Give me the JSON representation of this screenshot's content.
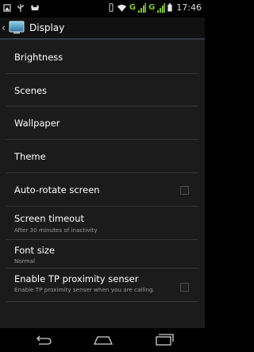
{
  "status_bar": {
    "time": "17:46",
    "network_label_1": "G",
    "network_label_2": "G",
    "icons": [
      "screenshot-icon",
      "usb-icon",
      "cat-icon",
      "vibrate-icon",
      "wifi-icon",
      "signal-icon",
      "battery-icon"
    ]
  },
  "action_bar": {
    "title": "Display",
    "up_icon": "chevron-left-icon",
    "app_icon": "display-settings-icon"
  },
  "settings": [
    {
      "title": "Brightness",
      "summary": "",
      "checkbox": false
    },
    {
      "title": "Scenes",
      "summary": "",
      "checkbox": false
    },
    {
      "title": "Wallpaper",
      "summary": "",
      "checkbox": false
    },
    {
      "title": "Theme",
      "summary": "",
      "checkbox": false
    },
    {
      "title": "Auto-rotate screen",
      "summary": "",
      "checkbox": true,
      "checked": false
    },
    {
      "title": "Screen timeout",
      "summary": "After 30 minutes of inactivity",
      "checkbox": false
    },
    {
      "title": "Font size",
      "summary": "Normal",
      "checkbox": false
    },
    {
      "title": "Enable TP proximity senser",
      "summary": "Enable TP proximity senser when you are calling.",
      "checkbox": true,
      "checked": false
    }
  ],
  "nav_bar": {
    "buttons": [
      "back-icon",
      "home-icon",
      "recent-apps-icon"
    ]
  },
  "colors": {
    "background": "#1b1b1b",
    "divider": "#333535",
    "signal": "#7ec622",
    "text_primary": "#ffffff",
    "text_secondary": "#9a9a9a"
  }
}
